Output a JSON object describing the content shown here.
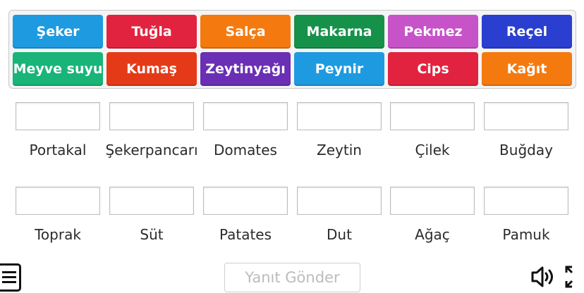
{
  "tiles": [
    {
      "label": "Şeker",
      "color": "#1e9ae0"
    },
    {
      "label": "Tuğla",
      "color": "#e2233f"
    },
    {
      "label": "Salça",
      "color": "#f47a10"
    },
    {
      "label": "Makarna",
      "color": "#16914a"
    },
    {
      "label": "Pekmez",
      "color": "#c653c8"
    },
    {
      "label": "Reçel",
      "color": "#2a3fcf"
    },
    {
      "label": "Meyve suyu",
      "color": "#18b478"
    },
    {
      "label": "Kumaş",
      "color": "#e53a17"
    },
    {
      "label": "Zeytinyağı",
      "color": "#6a2fb4"
    },
    {
      "label": "Peynir",
      "color": "#1e9ae0"
    },
    {
      "label": "Cips",
      "color": "#e2233f"
    },
    {
      "label": "Kağıt",
      "color": "#f47a10"
    }
  ],
  "targets": [
    {
      "label": "Portakal"
    },
    {
      "label": "Şekerpancarı"
    },
    {
      "label": "Domates"
    },
    {
      "label": "Zeytin"
    },
    {
      "label": "Çilek"
    },
    {
      "label": "Buğday"
    },
    {
      "label": "Toprak"
    },
    {
      "label": "Süt"
    },
    {
      "label": "Patates"
    },
    {
      "label": "Dut"
    },
    {
      "label": "Ağaç"
    },
    {
      "label": "Pamuk"
    }
  ],
  "controls": {
    "submit_label": "Yanıt Gönder",
    "menu_icon": "hamburger-menu-icon",
    "sound_icon": "speaker-icon",
    "fullscreen_icon": "fullscreen-icon"
  }
}
